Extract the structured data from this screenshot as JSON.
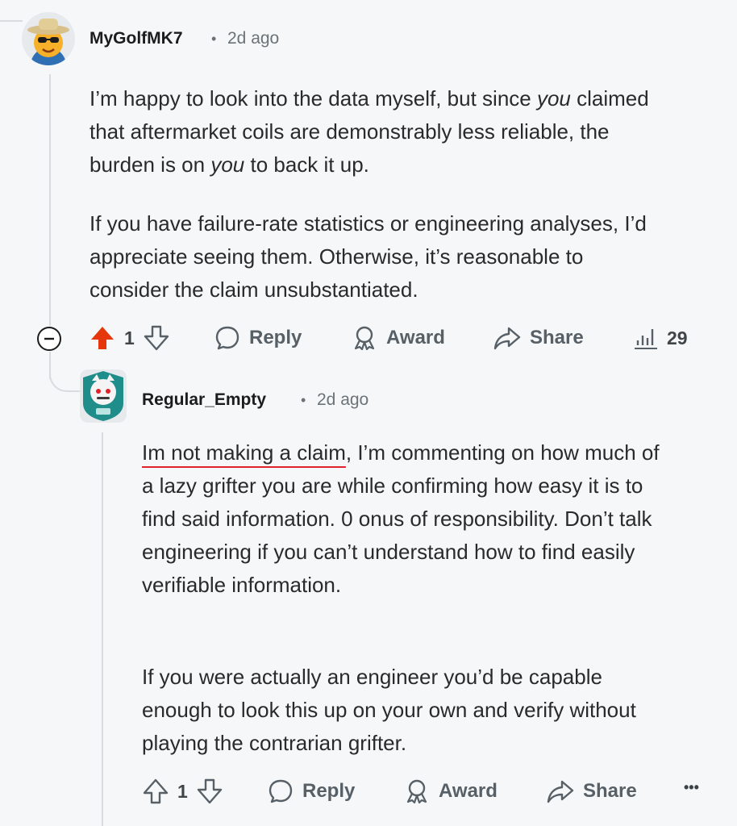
{
  "comment1": {
    "username": "MyGolfMK7",
    "separator": "•",
    "time": "2d ago",
    "p1_a": "I’m happy to look into the data myself, but since ",
    "p1_you1": "you",
    "p1_b": " claimed that aftermarket coils are demonstrably less reliable, the burden is on ",
    "p1_you2": "you",
    "p1_c": " to back it up.",
    "p2": "If you have failure-rate statistics or engineering analyses, I’d appreciate seeing them. Otherwise, it’s reasonable to consider the claim unsubstantiated.",
    "actions": {
      "vote_count": "1",
      "reply": "Reply",
      "award": "Award",
      "share": "Share",
      "views": "29"
    }
  },
  "comment2": {
    "username": "Regular_Empty",
    "separator": "•",
    "time": "2d ago",
    "p1_underlined": "Im not making a claim",
    "p1_rest": ", I’m commenting on how much of a lazy grifter you are while confirming how easy it is to find said information. 0 onus of responsibility. Don’t talk engineering if you can’t understand how to find easily verifiable information.",
    "p2": "If you were actually an engineer you’d be capable enough to look this up on your own and verify without playing the contrarian grifter.",
    "actions": {
      "vote_count": "1",
      "reply": "Reply",
      "award": "Award",
      "share": "Share",
      "more": "•••"
    }
  },
  "colors": {
    "upvote_active": "#e5370b",
    "underline": "#e0222b",
    "meta_gray": "#6b7378"
  }
}
